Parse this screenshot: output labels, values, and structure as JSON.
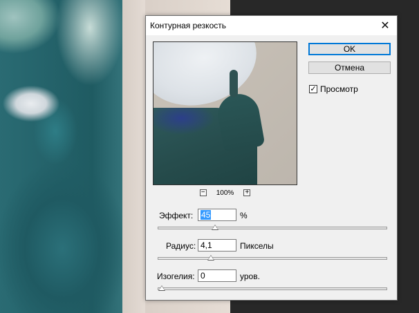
{
  "dialog": {
    "title": "Контурная резкость",
    "close_glyph": "✕"
  },
  "preview": {
    "zoom_out": "−",
    "zoom_level": "100%",
    "zoom_in": "+"
  },
  "buttons": {
    "ok": "OK",
    "cancel": "Отмена"
  },
  "preview_toggle": {
    "label": "Просмотр",
    "checked": true,
    "check_glyph": "✓"
  },
  "params": {
    "amount": {
      "label": "Эффект:",
      "value": "45",
      "unit": "%",
      "slider_fraction": 0.24
    },
    "radius": {
      "label": "Радиус:",
      "value": "4,1",
      "unit": "Пикселы",
      "slider_fraction": 0.22
    },
    "threshold": {
      "label": "Изогелия:",
      "value": "0",
      "unit": "уров.",
      "slider_fraction": 0.0
    }
  }
}
